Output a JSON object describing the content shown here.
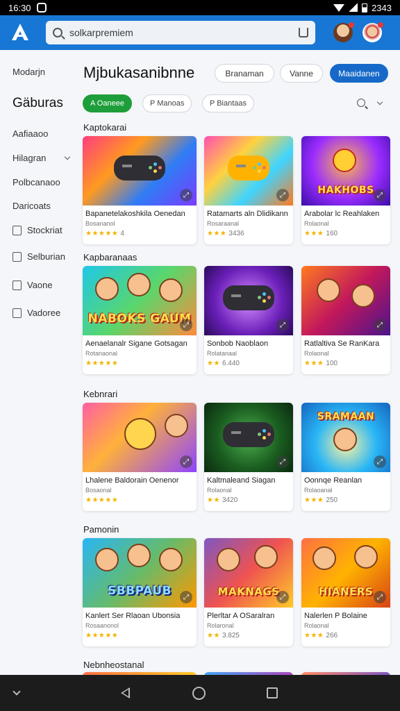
{
  "status_bar": {
    "time": "16:30",
    "battery_text": "2343"
  },
  "app_bar": {
    "search_value": "solkarpremiem"
  },
  "sidebar": {
    "items": [
      {
        "label": "Modarjn",
        "icon": "none"
      },
      {
        "label": "Gäburas",
        "icon": "none"
      },
      {
        "label": "Aafiaaoo",
        "icon": "none"
      },
      {
        "label": "Hilagran",
        "icon": "chevron-down-icon"
      },
      {
        "label": "Polbcanaoo",
        "icon": "none"
      },
      {
        "label": "Daricoats",
        "icon": "none"
      },
      {
        "label": "Stockriat",
        "icon": "checklist-icon"
      },
      {
        "label": "Selburian",
        "icon": "document-icon"
      },
      {
        "label": "Vaone",
        "icon": "checklist-icon"
      },
      {
        "label": "Vadoree",
        "icon": "list-icon"
      }
    ]
  },
  "main": {
    "title": "Mjbukasanibnne",
    "buttons": [
      "Branaman",
      "Vanne",
      "Maaidanen"
    ],
    "chips": [
      "A Oaneee",
      "P Manoas",
      "P Biantaas"
    ],
    "sections": [
      {
        "title": "Kaptokarai",
        "cards": [
          {
            "title": "Bapanetelakoshkila Oenedan",
            "sub": "Bosananol",
            "rating": "4",
            "stars": "★★★★★",
            "banner": ""
          },
          {
            "title": "Ratamarts aln Dlidikann",
            "sub": "Rosaraanal",
            "rating": "3436",
            "stars": "★★★",
            "banner": ""
          },
          {
            "title": "Arabolar lc Reahlaken",
            "sub": "Rolaonal",
            "rating": "160",
            "stars": "★★★",
            "banner": "HAKHOBS"
          }
        ]
      },
      {
        "title": "Kapbaranaas",
        "cards": [
          {
            "title": "Aenaelanalr Sigane Gotsagan",
            "sub": "Rotanaonal",
            "rating": "",
            "stars": "★★★★★",
            "banner": "NABOKS GAUM"
          },
          {
            "title": "Sonbob Naoblaon",
            "sub": "Rolatanaal",
            "rating": "6.440",
            "stars": "★★",
            "banner": ""
          },
          {
            "title": "Ratlaltiva Se RanKara",
            "sub": "Rolaonal",
            "rating": "100",
            "stars": "★★★",
            "banner": ""
          }
        ]
      },
      {
        "title": "Kebnrari",
        "cards": [
          {
            "title": "Lhalene Baldorain Oenenor",
            "sub": "Bosaonal",
            "rating": "",
            "stars": "★★★★★",
            "banner": ""
          },
          {
            "title": "Kaltmaleand Siagan",
            "sub": "Rolaonal",
            "rating": "3420",
            "stars": "★★",
            "banner": ""
          },
          {
            "title": "Oonnqe Reanlan",
            "sub": "Rolaoanal",
            "rating": "250",
            "stars": "★★★",
            "banner": "SRAMAAN"
          }
        ]
      },
      {
        "title": "Pamonin",
        "cards": [
          {
            "title": "Kanlert Ser Rlaoan Ubonsia",
            "sub": "Rosaanonol",
            "rating": "",
            "stars": "★★★★★",
            "banner": "SBBPAUB"
          },
          {
            "title": "Plerltar A OSaralran",
            "sub": "Rolaronal",
            "rating": "3.825",
            "stars": "★★",
            "banner": "MAKNAGS"
          },
          {
            "title": "Nalerlen P Bolaine",
            "sub": "Rolaonal",
            "rating": "266",
            "stars": "★★★",
            "banner": "HIANERS"
          }
        ]
      },
      {
        "title": "Nebnheostanal",
        "cards": []
      }
    ]
  },
  "colors": {
    "app_bar": "#1877d4",
    "primary_button": "#1669c8",
    "active_chip": "#1e9e3a",
    "star": "#f2b400"
  }
}
